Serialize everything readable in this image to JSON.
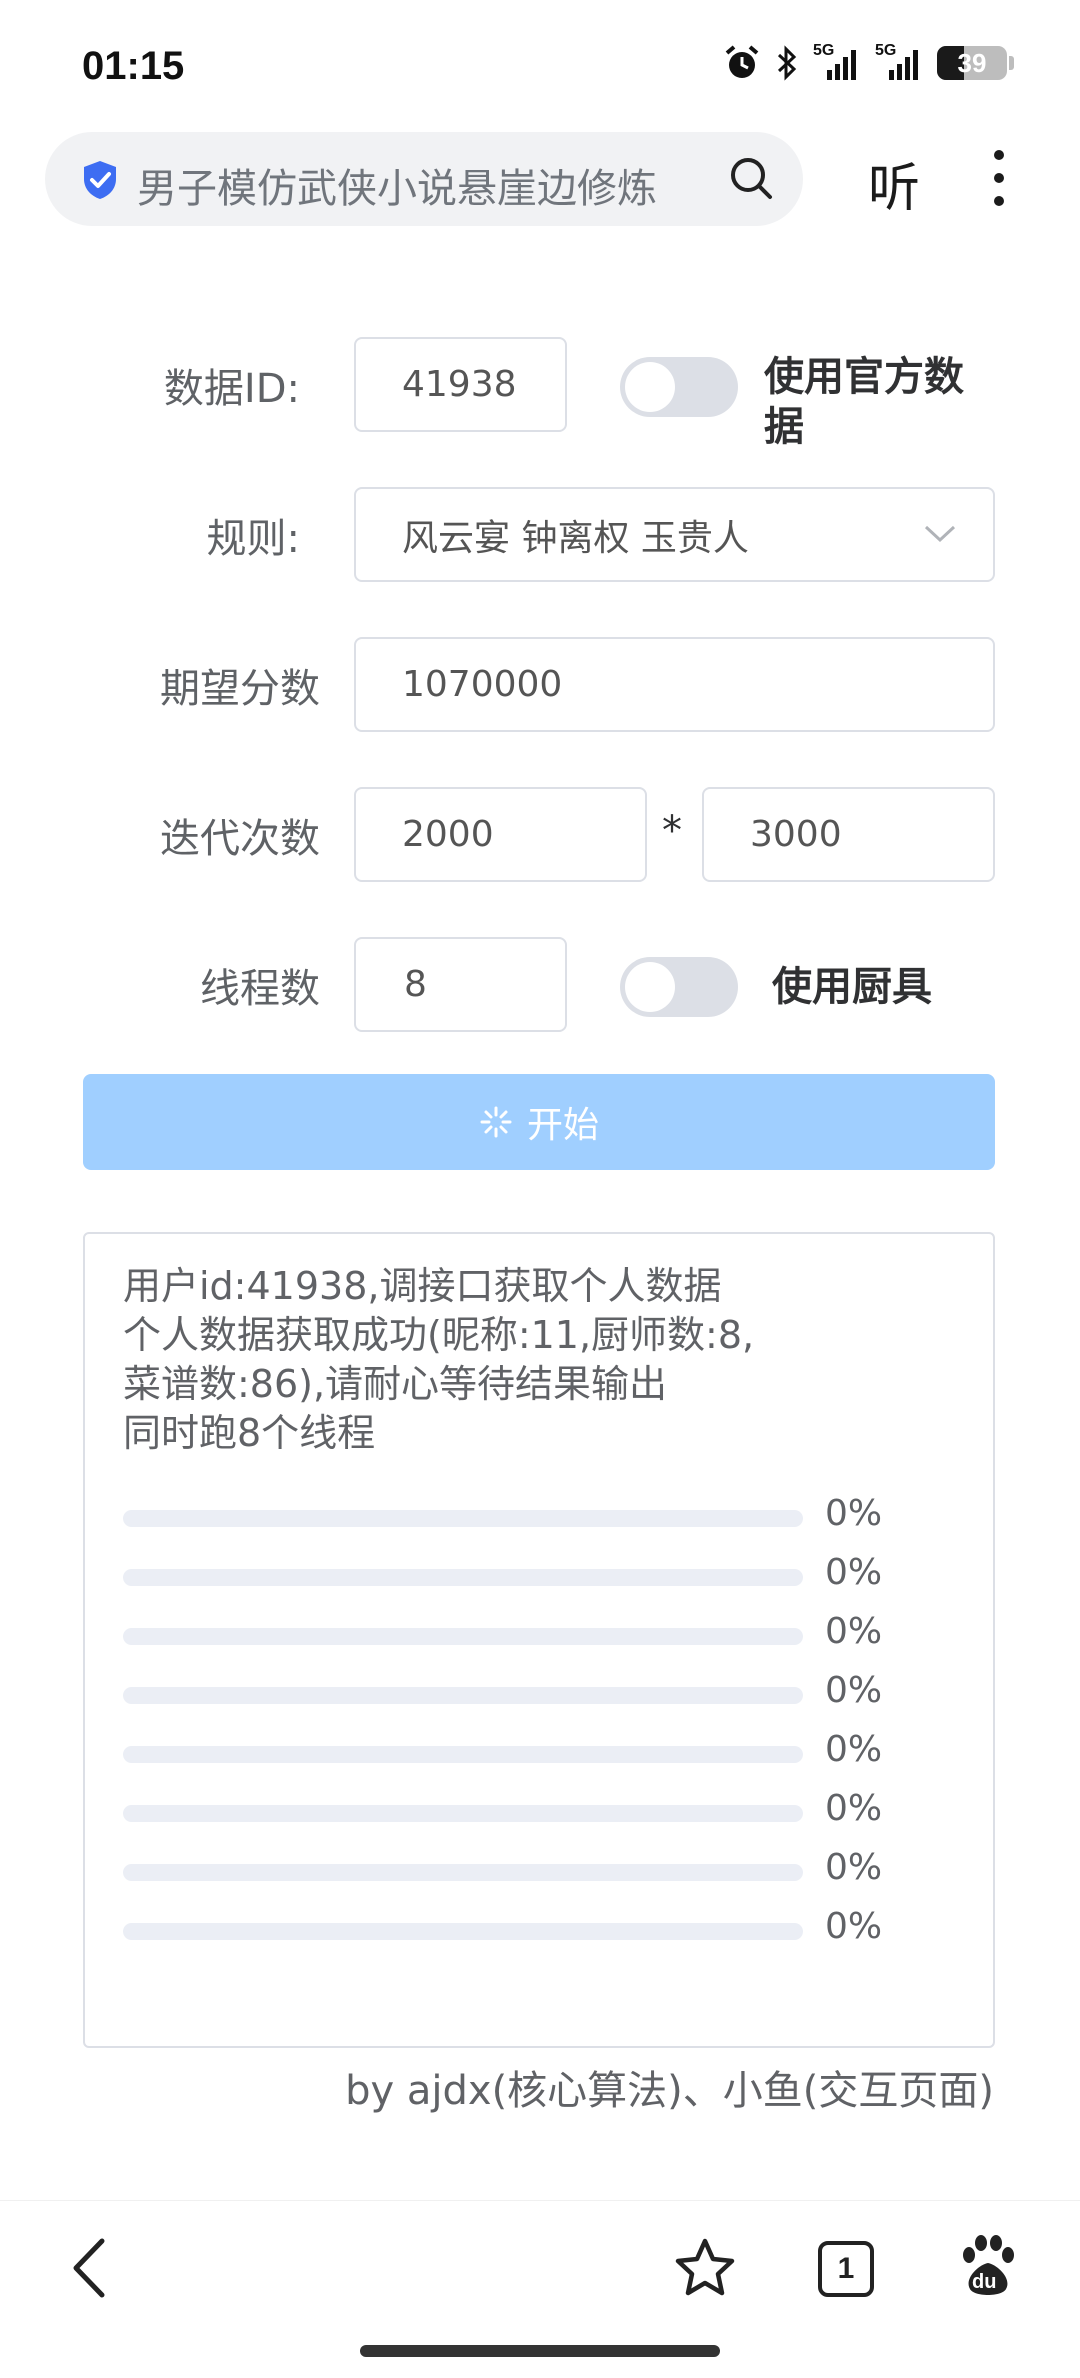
{
  "status_bar": {
    "time": "01:15",
    "signal1": "5G",
    "signal2": "5G",
    "battery": "39",
    "battery_level": 0.39
  },
  "browser": {
    "search_text": "男子模仿武侠小说悬崖边修炼",
    "listen_label": "听"
  },
  "form": {
    "data_id": {
      "label": "数据ID:",
      "value": "41938"
    },
    "official_data_switch": {
      "label": "使用官方数据",
      "on": false
    },
    "rule": {
      "label": "规则:",
      "value": "风云宴 钟离权 玉贵人"
    },
    "expected_score": {
      "label": "期望分数",
      "value": "1070000"
    },
    "iterations": {
      "label": "迭代次数",
      "value1": "2000",
      "separator": "*",
      "value2": "3000"
    },
    "threads": {
      "label": "线程数",
      "value": "8"
    },
    "use_chef_tools_switch": {
      "label": "使用厨具",
      "on": false
    },
    "start_button": "开始"
  },
  "log": {
    "lines": [
      "用户id:41938,调接口获取个人数据",
      "个人数据获取成功(昵称:11,厨师数:8,",
      "菜谱数:86),请耐心等待结果输出",
      "同时跑8个线程"
    ],
    "progress": [
      {
        "label": "0%",
        "value": 0
      },
      {
        "label": "0%",
        "value": 0
      },
      {
        "label": "0%",
        "value": 0
      },
      {
        "label": "0%",
        "value": 0
      },
      {
        "label": "0%",
        "value": 0
      },
      {
        "label": "0%",
        "value": 0
      },
      {
        "label": "0%",
        "value": 0
      },
      {
        "label": "0%",
        "value": 0
      }
    ]
  },
  "credits": "by ajdx(核心算法)、小鱼(交互页面)",
  "bottom_nav": {
    "tab_count": "1",
    "baidu_label": "du"
  },
  "colors": {
    "primary_disabled": "#a0cfff",
    "border": "#dcdfe6",
    "track": "#ebeef5",
    "shield": "#3d6df2"
  }
}
